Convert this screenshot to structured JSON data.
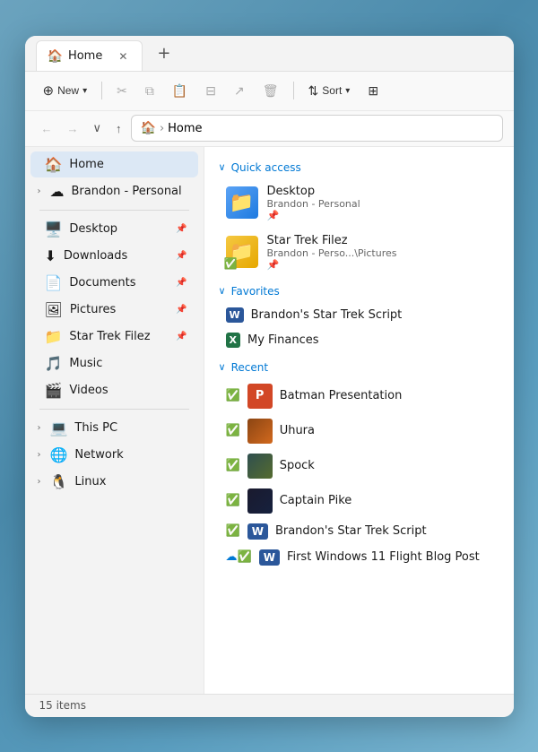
{
  "window": {
    "title": "Home",
    "tab_label": "Home"
  },
  "toolbar": {
    "new_label": "New",
    "sort_label": "Sort",
    "new_dropdown": "▾",
    "sort_dropdown": "▾"
  },
  "address": {
    "path_home": "🏠",
    "path_sep": "›",
    "path_label": "Home"
  },
  "sidebar": {
    "home_label": "Home",
    "brandon_label": "Brandon - Personal",
    "desktop_label": "Desktop",
    "downloads_label": "Downloads",
    "documents_label": "Documents",
    "pictures_label": "Pictures",
    "star_trek_label": "Star Trek Filez",
    "music_label": "Music",
    "videos_label": "Videos",
    "this_pc_label": "This PC",
    "network_label": "Network",
    "linux_label": "Linux"
  },
  "quick_access": {
    "section_label": "Quick access",
    "items": [
      {
        "name": "Desktop",
        "path": "Brandon - Personal",
        "pin": "📌"
      },
      {
        "name": "Star Trek Filez",
        "path": "Brandon - Perso...\\Pictures",
        "pin": "📌"
      }
    ]
  },
  "favorites": {
    "section_label": "Favorites",
    "items": [
      {
        "name": "Brandon's Star Trek Script",
        "icon": "W"
      },
      {
        "name": "My Finances",
        "icon": "X"
      }
    ]
  },
  "recent": {
    "section_label": "Recent",
    "items": [
      {
        "name": "Batman Presentation",
        "type": "ppt",
        "cloud": false
      },
      {
        "name": "Uhura",
        "type": "img_uhura",
        "cloud": false
      },
      {
        "name": "Spock",
        "type": "img_spock",
        "cloud": false
      },
      {
        "name": "Captain Pike",
        "type": "img_pike",
        "cloud": false
      },
      {
        "name": "Brandon's Star Trek Script",
        "type": "word",
        "cloud": false
      },
      {
        "name": "First Windows 11 Flight Blog Post",
        "type": "word",
        "cloud": true
      }
    ]
  },
  "status_bar": {
    "items_count": "15 items"
  }
}
